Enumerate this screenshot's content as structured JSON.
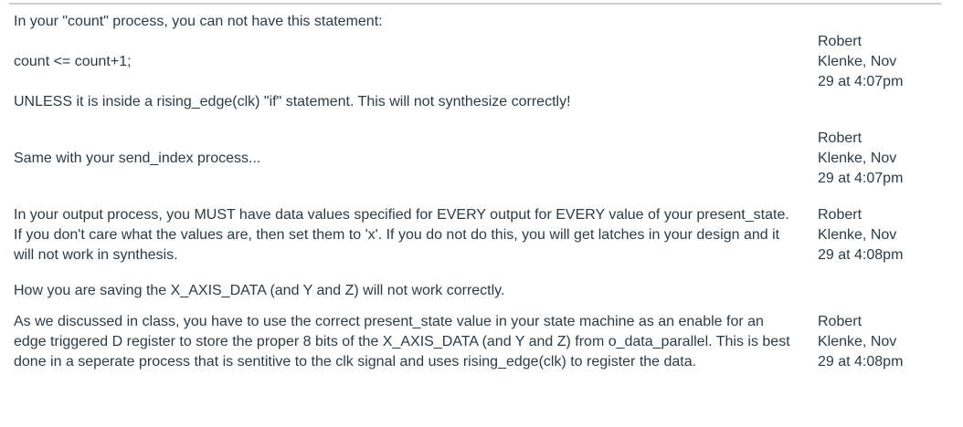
{
  "comments": [
    {
      "paragraphs": [
        "In your \"count\" process, you can not have this statement:",
        "count <= count+1;",
        "UNLESS it is inside a rising_edge(clk) \"if\" statement. This will not synthesize correctly!"
      ],
      "author": "Robert Klenke,",
      "author_line1": "Robert",
      "author_line2": "Klenke, Nov",
      "time_line": "29 at 4:07pm"
    },
    {
      "paragraphs": [
        "Same with your send_index process..."
      ],
      "author_line1": "Robert",
      "author_line2": "Klenke, Nov",
      "time_line": "29 at 4:07pm"
    },
    {
      "paragraphs": [
        "In your output process, you MUST have data values specified for EVERY output for EVERY value of your present_state. If you don't care what the values are, then set them to 'x'. If you do not do this, you will get latches in your design and it will not work in synthesis."
      ],
      "author_line1": "Robert",
      "author_line2": "Klenke, Nov",
      "time_line": "29 at 4:08pm"
    },
    {
      "paragraphs": [
        "How you are saving the X_AXIS_DATA (and Y and Z)  will not work correctly.",
        "As we discussed in class, you have to use the correct present_state value in your state machine as an enable for an edge triggered D register to store the proper 8 bits of the X_AXIS_DATA (and Y and Z) from o_data_parallel. This is best done in a seperate process that is sentitive to the clk signal and uses rising_edge(clk) to register the data."
      ],
      "author_line1": "Robert",
      "author_line2": "Klenke, Nov",
      "time_line": "29 at 4:08pm"
    }
  ]
}
